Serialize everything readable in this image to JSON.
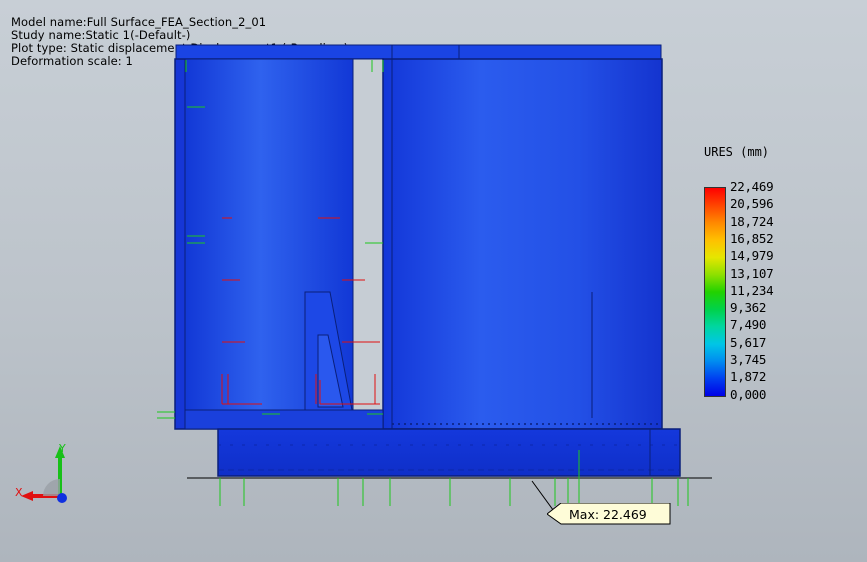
{
  "info": {
    "model_name": "Model name:Full Surface_FEA_Section_2_01",
    "study_name": "Study name:Static 1(-Default-)",
    "plot_type": "Plot type: Static displacement Displacement1 (-Res disp-)",
    "deformation_scale": "Deformation scale: 1"
  },
  "legend": {
    "title": "URES (mm)",
    "ticks": [
      "22,469",
      "20,596",
      "18,724",
      "16,852",
      "14,979",
      "13,107",
      "11,234",
      "9,362",
      "7,490",
      "5,617",
      "3,745",
      "1,872",
      "0,000"
    ],
    "colors": {
      "max": "#ff0000",
      "mid": "#22d200",
      "min": "#0000e6"
    }
  },
  "max_label": "Max: 22.469",
  "triad": {
    "y_label": "Y",
    "x_label": "X",
    "y_color": "#18c018",
    "x_color": "#e01010",
    "z_color": "#1030e0"
  },
  "model_colors": {
    "body": "#1a3fe0",
    "edge": "#0a1f7a"
  }
}
